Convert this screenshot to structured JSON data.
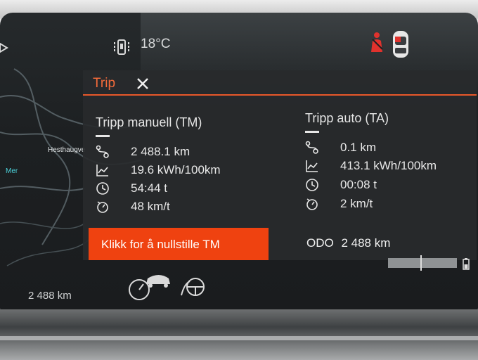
{
  "status": {
    "temperature": "18°C"
  },
  "panel": {
    "title": "Trip",
    "manual": {
      "title": "Tripp manuell (TM)",
      "distance": "2 488.1 km",
      "consumption": "19.6 kWh/100km",
      "time": "54:44 t",
      "speed": "48 km/t"
    },
    "auto": {
      "title": "Tripp auto (TA)",
      "distance": "0.1 km",
      "consumption": "413.1 kWh/100km",
      "time": "00:08 t",
      "speed": "2 km/t"
    },
    "reset_label": "Klikk for å nullstille TM",
    "odo_label": "ODO",
    "odo_value": "2 488 km"
  },
  "map": {
    "street": "Hesthaugve",
    "label": "Mer"
  },
  "cluster": {
    "range": "2 488 km"
  },
  "colors": {
    "accent": "#f26a3a",
    "button": "#ef4210",
    "warning": "#e0322d"
  },
  "icons": [
    "phone-icon",
    "seatbelt-warning-icon",
    "car-top-icon",
    "close-icon",
    "distance-icon",
    "consumption-icon",
    "clock-icon",
    "speed-icon",
    "battery-icon"
  ]
}
